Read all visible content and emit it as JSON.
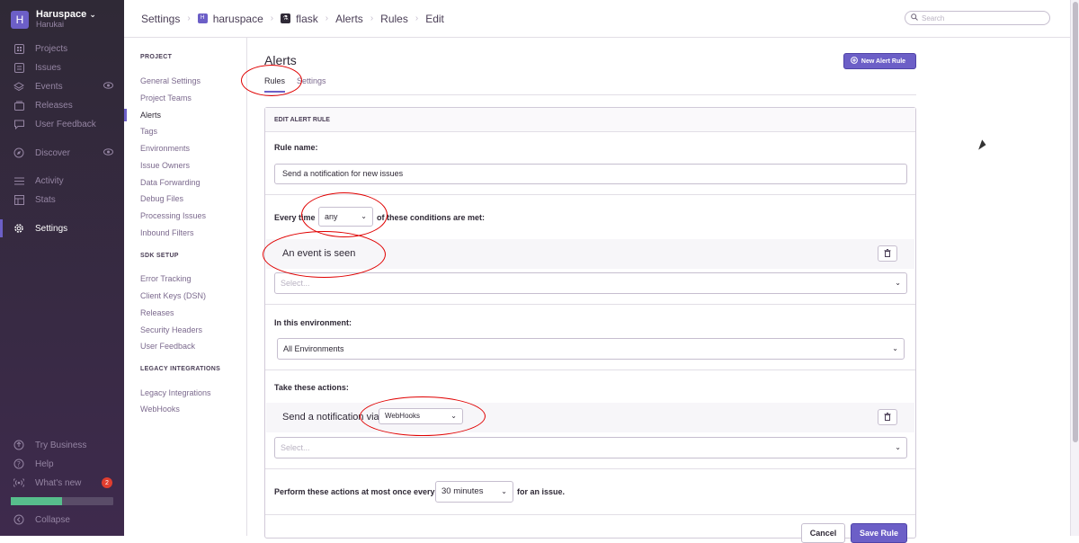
{
  "org": {
    "initial": "H",
    "name": "Haruspace",
    "chevron": "⌄",
    "sub": "Harukai"
  },
  "nav": [
    {
      "label": "Projects",
      "icon": "projects-icon"
    },
    {
      "label": "Issues",
      "icon": "issues-icon"
    },
    {
      "label": "Events",
      "icon": "events-icon"
    },
    {
      "label": "Releases",
      "icon": "releases-icon"
    },
    {
      "label": "User Feedback",
      "icon": "user-feedback-icon"
    },
    {
      "label": "Discover",
      "icon": "discover-icon"
    },
    {
      "label": "Activity",
      "icon": "activity-icon"
    },
    {
      "label": "Stats",
      "icon": "stats-icon"
    },
    {
      "label": "Settings",
      "icon": "settings-icon"
    }
  ],
  "nav_bottom": [
    {
      "label": "Try Business",
      "icon": "business-icon"
    },
    {
      "label": "Help",
      "icon": "help-icon"
    },
    {
      "label": "What's new",
      "icon": "broadcast-icon",
      "badge": "2"
    },
    {
      "label": "Collapse",
      "icon": "collapse-icon"
    }
  ],
  "trial_progress": 0.5,
  "breadcrumb": [
    "Settings",
    "haruspace",
    "flask",
    "Alerts",
    "Rules",
    "Edit"
  ],
  "search": {
    "placeholder": "Search"
  },
  "settings_nav": {
    "project_heading": "PROJECT",
    "project_items": [
      "General Settings",
      "Project Teams",
      "Alerts",
      "Tags",
      "Environments",
      "Issue Owners",
      "Data Forwarding",
      "Debug Files",
      "Processing Issues",
      "Inbound Filters"
    ],
    "sdk_heading": "SDK SETUP",
    "sdk_items": [
      "Error Tracking",
      "Client Keys (DSN)",
      "Releases",
      "Security Headers",
      "User Feedback"
    ],
    "legacy_heading": "LEGACY INTEGRATIONS",
    "legacy_items": [
      "Legacy Integrations",
      "WebHooks"
    ]
  },
  "page": {
    "title": "Alerts",
    "new_button": "New Alert Rule",
    "tabs": [
      "Rules",
      "Settings"
    ]
  },
  "form": {
    "header": "EDIT ALERT RULE",
    "rule_name_label": "Rule name:",
    "rule_name_value": "Send a notification for new issues",
    "every_time": "Every time",
    "match_value": "any",
    "conditions_suffix": "of these conditions are met:",
    "condition": "An event is seen",
    "select_placeholder": "Select...",
    "environment_label": "In this environment:",
    "environment_value": "All Environments",
    "actions_label": "Take these actions:",
    "action_text": "Send a notification via",
    "action_service": "WebHooks",
    "frequency_prefix": "Perform these actions at most once every",
    "frequency_value": "30 minutes",
    "frequency_suffix": "for an issue.",
    "cancel": "Cancel",
    "save": "Save Rule"
  }
}
